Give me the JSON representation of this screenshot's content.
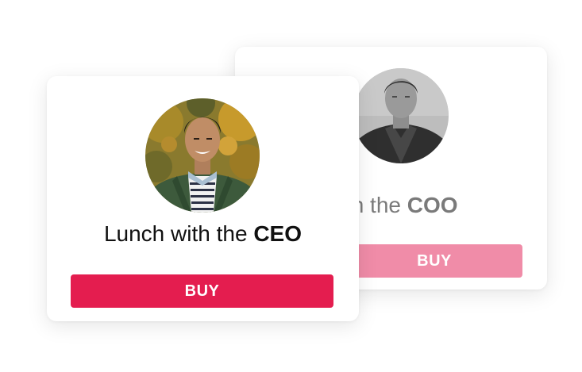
{
  "cards": [
    {
      "id": "ceo",
      "title_prefix": "Lunch with the",
      "title_role": "CEO",
      "buy_label": "BUY",
      "button_color": "#e41d4f",
      "avatar_icon": "person-avatar-photo"
    },
    {
      "id": "coo",
      "title_prefix": "with the",
      "title_role": "COO",
      "buy_label": "BUY",
      "button_color": "#f08ca8",
      "avatar_icon": "person-avatar-photo"
    }
  ]
}
